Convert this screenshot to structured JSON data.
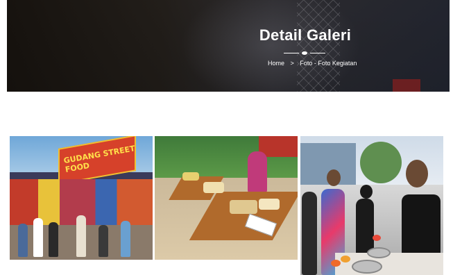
{
  "header": {
    "title": "Detail Galeri",
    "breadcrumb": {
      "home": "Home",
      "separator": ">",
      "current": "Foto - Foto Kegiatan"
    }
  },
  "gallery": {
    "items": [
      {
        "banner_text": "GUDANG STREET FOOD"
      },
      {
        "banner_text": ""
      },
      {
        "banner_text": ""
      }
    ]
  }
}
